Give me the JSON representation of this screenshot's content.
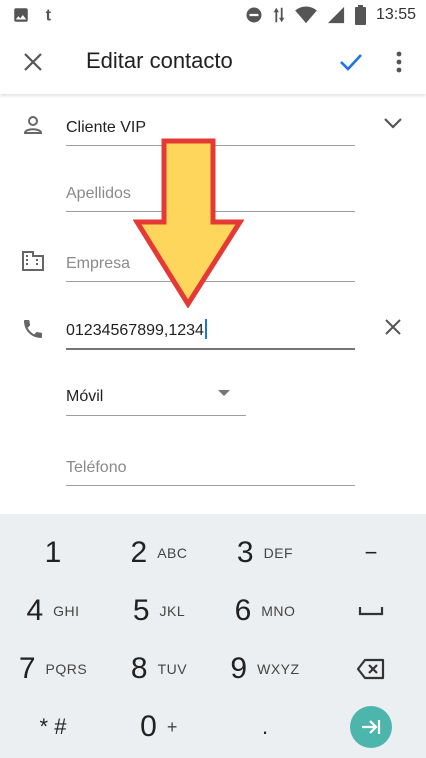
{
  "status_bar": {
    "time": "13:55",
    "left_icons": [
      "image-icon",
      "tumblr-icon"
    ],
    "right_icons": [
      "do-not-disturb-icon",
      "data-arrows-icon",
      "wifi-icon",
      "signal-icon",
      "battery-icon"
    ]
  },
  "app_bar": {
    "title": "Editar contacto",
    "close_icon": "close-icon",
    "save_icon": "check-icon",
    "more_icon": "more-vert-icon",
    "accent_color": "#1a73e8"
  },
  "form": {
    "name": {
      "value": "Cliente VIP",
      "expand_icon": "chevron-down-icon"
    },
    "last_name": {
      "placeholder": "Apellidos"
    },
    "company": {
      "placeholder": "Empresa"
    },
    "phone": {
      "value": "01234567899,1234",
      "clear_icon": "close-icon"
    },
    "phone_type": {
      "selected": "Móvil"
    },
    "phone_new": {
      "placeholder": "Teléfono"
    }
  },
  "annotation": {
    "color_fill": "#fdd65b",
    "color_stroke": "#e53935"
  },
  "keyboard": {
    "keys": [
      {
        "main": "1",
        "sub": ""
      },
      {
        "main": "2",
        "sub": "ABC"
      },
      {
        "main": "3",
        "sub": "DEF"
      },
      {
        "main": "−",
        "sub": ""
      },
      {
        "main": "4",
        "sub": "GHI"
      },
      {
        "main": "5",
        "sub": "JKL"
      },
      {
        "main": "6",
        "sub": "MNO"
      },
      {
        "main": "␣",
        "sub": ""
      },
      {
        "main": "7",
        "sub": "PQRS"
      },
      {
        "main": "8",
        "sub": "TUV"
      },
      {
        "main": "9",
        "sub": "WXYZ"
      },
      {
        "main": "⌫",
        "sub": ""
      },
      {
        "main": "* #",
        "sub": ""
      },
      {
        "main": "0",
        "sub": "+"
      },
      {
        "main": ".",
        "sub": ""
      },
      {
        "main": "→|",
        "sub": ""
      }
    ],
    "go_color": "#4db6ac"
  }
}
